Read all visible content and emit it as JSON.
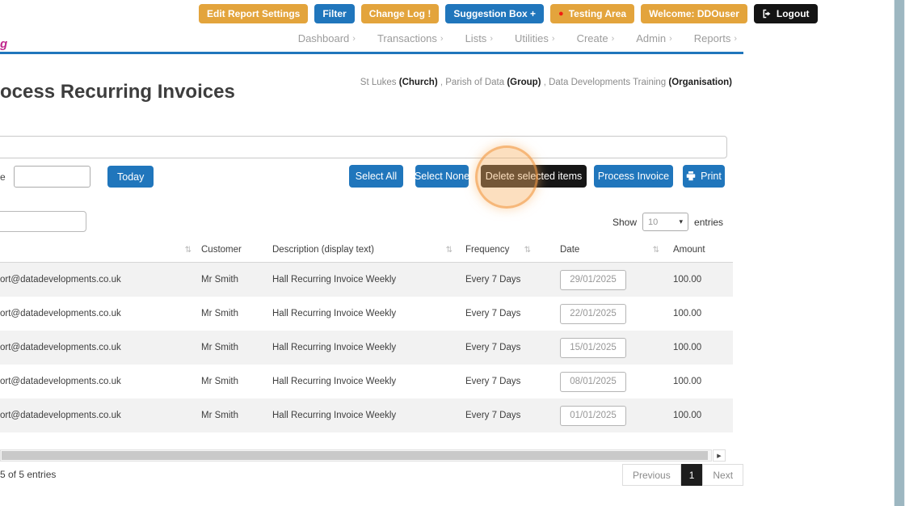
{
  "fragments": {
    "logo": "g",
    "date_label": "e"
  },
  "topbar": {
    "edit_report_settings": "Edit Report Settings",
    "filter": "Filter",
    "change_log": "Change Log !",
    "suggestion_box": "Suggestion Box +",
    "testing_area": "Testing Area",
    "welcome": "Welcome: DDOuser",
    "logout": "Logout"
  },
  "nav": {
    "items": [
      {
        "label": "Dashboard"
      },
      {
        "label": "Transactions"
      },
      {
        "label": "Lists"
      },
      {
        "label": "Utilities"
      },
      {
        "label": "Create"
      },
      {
        "label": "Admin"
      },
      {
        "label": "Reports"
      }
    ]
  },
  "header": {
    "title": "ocess Recurring Invoices",
    "context": [
      {
        "name": "St Lukes",
        "type": "(Church)"
      },
      {
        "name": "Parish of Data",
        "type": "(Group)"
      },
      {
        "name": "Data Developments Training",
        "type": "(Organisation)"
      }
    ],
    "context_separator": " , "
  },
  "toolbar": {
    "today": "Today",
    "select_all": "Select All",
    "select_none": "Select None",
    "delete_selected": "Delete selected items",
    "process_invoice": "Process Invoice",
    "print": "Print"
  },
  "table_controls": {
    "show_label": "Show",
    "page_size": "10",
    "entries_label": "entries"
  },
  "table": {
    "columns": {
      "customer": "Customer",
      "description": "Description (display text)",
      "frequency": "Frequency",
      "date": "Date",
      "amount": "Amount"
    },
    "rows": [
      {
        "email": "ort@datadevelopments.co.uk",
        "customer": "Mr Smith",
        "description": "Hall Recurring Invoice Weekly",
        "frequency": "Every 7 Days",
        "date": "29/01/2025",
        "amount": "100.00"
      },
      {
        "email": "ort@datadevelopments.co.uk",
        "customer": "Mr Smith",
        "description": "Hall Recurring Invoice Weekly",
        "frequency": "Every 7 Days",
        "date": "22/01/2025",
        "amount": "100.00"
      },
      {
        "email": "ort@datadevelopments.co.uk",
        "customer": "Mr Smith",
        "description": "Hall Recurring Invoice Weekly",
        "frequency": "Every 7 Days",
        "date": "15/01/2025",
        "amount": "100.00"
      },
      {
        "email": "ort@datadevelopments.co.uk",
        "customer": "Mr Smith",
        "description": "Hall Recurring Invoice Weekly",
        "frequency": "Every 7 Days",
        "date": "08/01/2025",
        "amount": "100.00"
      },
      {
        "email": "ort@datadevelopments.co.uk",
        "customer": "Mr Smith",
        "description": "Hall Recurring Invoice Weekly",
        "frequency": "Every 7 Days",
        "date": "01/01/2025",
        "amount": "100.00"
      }
    ]
  },
  "footer": {
    "entries_info": "5 of 5 entries",
    "previous": "Previous",
    "current_page": "1",
    "next": "Next"
  },
  "icons": {
    "sort": "⇅",
    "nav_chevron": "›",
    "dropdown_caret": "▾",
    "scroll_right": "▶",
    "testing_dot": "●"
  },
  "colors": {
    "orange": "#e3a43c",
    "blue": "#2076bc",
    "dark": "#141414",
    "highlight": "#f5a963",
    "magenta": "#c0268c",
    "red_dot": "#f21d12"
  }
}
